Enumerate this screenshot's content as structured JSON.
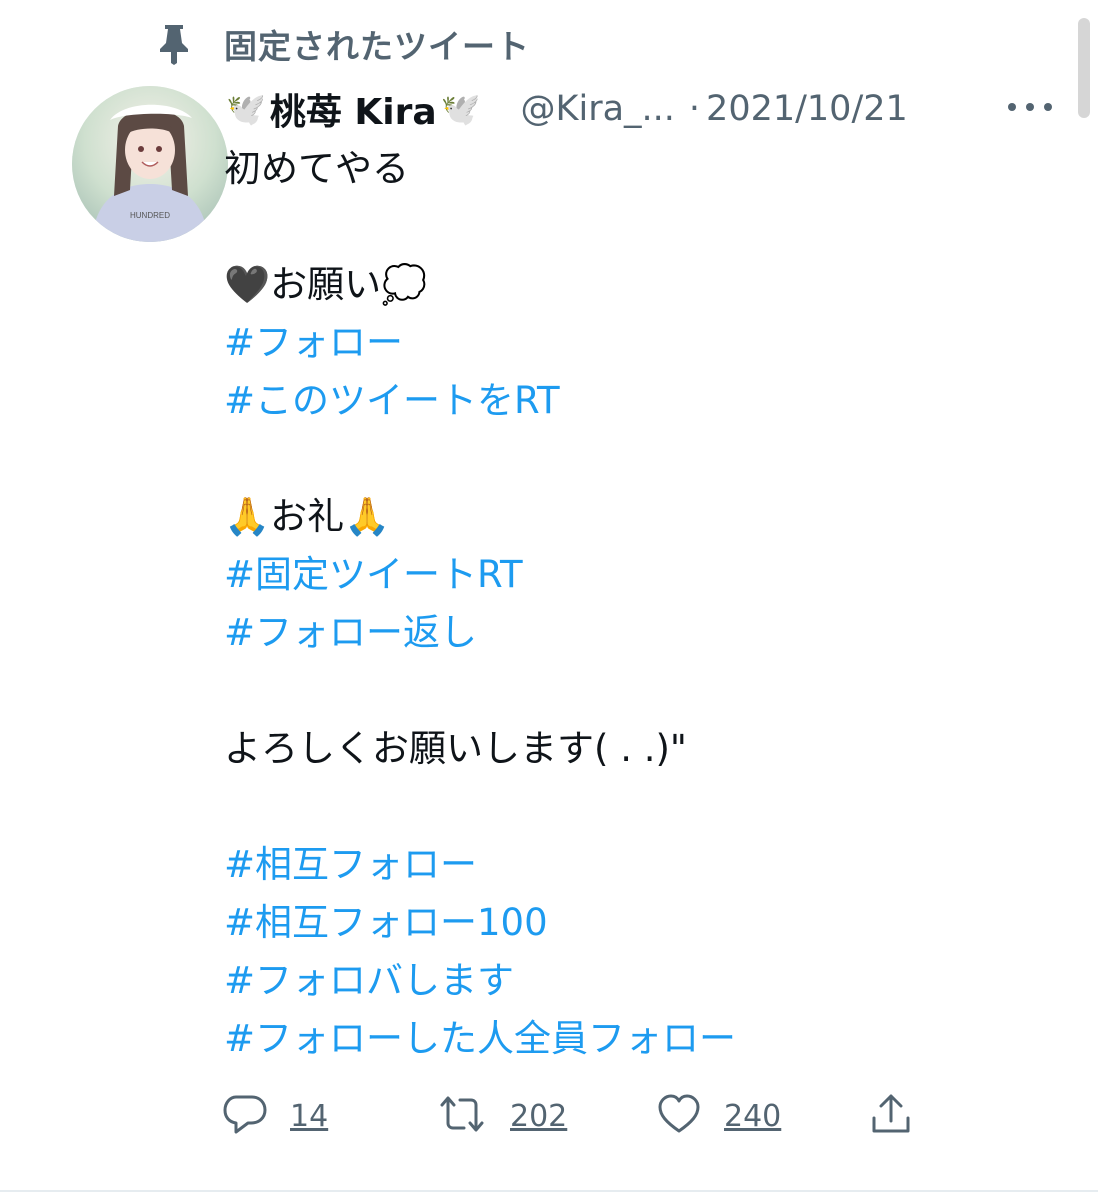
{
  "pinned": {
    "label": "固定されたツイート",
    "icon": "pin-icon"
  },
  "author": {
    "name_prefix_emoji": "🕊️",
    "display_name": "桃苺 Kira",
    "name_suffix_emoji": "🕊️",
    "handle": "@Kira_...",
    "separator": "·",
    "date": "2021/10/21"
  },
  "tweet": {
    "lines": [
      {
        "text": "初めてやる",
        "type": "text"
      },
      {
        "text": "",
        "type": "blank"
      },
      {
        "text": "🖤お願い💭",
        "type": "text"
      },
      {
        "text": "#フォロー",
        "type": "hashtag"
      },
      {
        "text": "#このツイートをRT",
        "type": "hashtag"
      },
      {
        "text": "",
        "type": "blank"
      },
      {
        "text": "🙏お礼🙏",
        "type": "text"
      },
      {
        "text": "#固定ツイートRT",
        "type": "hashtag"
      },
      {
        "text": "#フォロー返し",
        "type": "hashtag"
      },
      {
        "text": "",
        "type": "blank"
      },
      {
        "text": "よろしくお願いします(  . .)\"",
        "type": "text"
      },
      {
        "text": "",
        "type": "blank"
      },
      {
        "text": "#相互フォロー",
        "type": "hashtag"
      },
      {
        "text": "#相互フォロー100",
        "type": "hashtag"
      },
      {
        "text": "#フォロバします",
        "type": "hashtag"
      },
      {
        "text": "#フォローした人全員フォロー",
        "type": "hashtag"
      }
    ]
  },
  "actions": {
    "reply_count": "14",
    "retweet_count": "202",
    "like_count": "240"
  },
  "colors": {
    "accent": "#1d9bf0",
    "secondary": "#536471",
    "text": "#0f1419"
  }
}
